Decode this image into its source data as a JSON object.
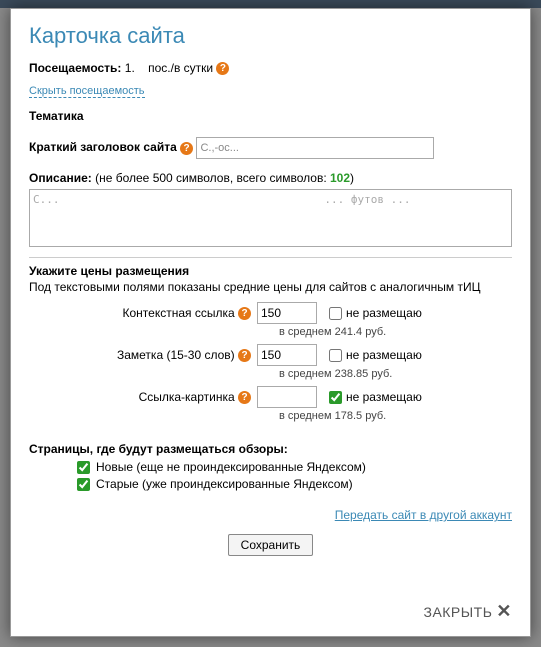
{
  "title": "Карточка сайта",
  "traffic": {
    "label": "Посещаемость:",
    "value": "1.",
    "unit": "пос./в сутки"
  },
  "hide_traffic": "Скрыть посещаемость",
  "topic_label": "Тематика",
  "short_title": {
    "label": "Краткий заголовок сайта",
    "value": "С.,-ос..."
  },
  "description": {
    "label": "Описание:",
    "hint_prefix": "(не более 500 символов, всего символов: ",
    "count": "102",
    "hint_suffix": ")",
    "text": "С...                                        ... футов ..."
  },
  "prices": {
    "head": "Укажите цены размещения",
    "sub": "Под текстовыми полями показаны средние цены для сайтов с аналогичным тИЦ",
    "rows": [
      {
        "label": "Контекстная ссылка",
        "value": "150",
        "avg": "в среднем 241.4 руб.",
        "nocb": false,
        "nolabel": "не размещаю"
      },
      {
        "label": "Заметка (15-30 слов)",
        "value": "150",
        "avg": "в среднем 238.85 руб.",
        "nocb": false,
        "nolabel": "не размещаю"
      },
      {
        "label": "Ссылка-картинка",
        "value": "",
        "avg": "в среднем 178.5 руб.",
        "nocb": true,
        "nolabel": "не размещаю"
      }
    ]
  },
  "pages": {
    "head": "Страницы, где будут размещаться обзоры:",
    "opts": [
      {
        "checked": true,
        "label": "Новые (еще не проиндексированные Яндексом)"
      },
      {
        "checked": true,
        "label": "Старые (уже проиндексированные Яндексом)"
      }
    ]
  },
  "transfer": "Передать сайт в другой аккаунт",
  "save": "Сохранить",
  "close": "ЗАКРЫТЬ"
}
